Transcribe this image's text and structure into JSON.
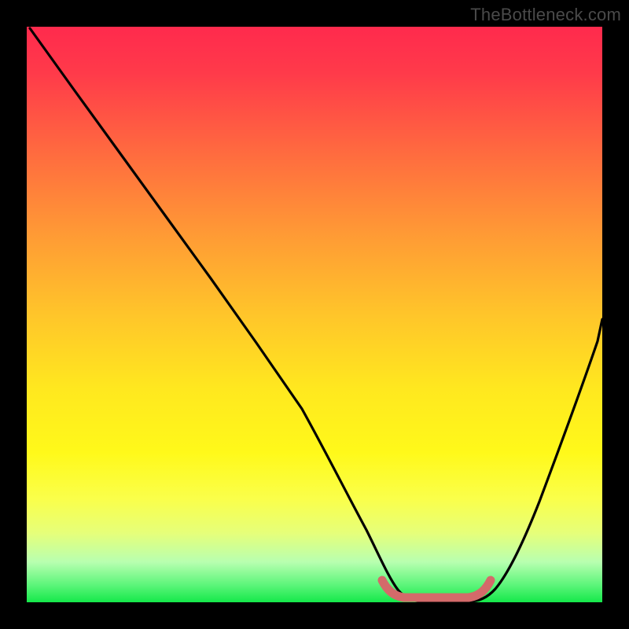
{
  "watermark": "TheBottleneck.com",
  "chart_data": {
    "type": "line",
    "title": "",
    "xlabel": "",
    "ylabel": "",
    "xlim": [
      0,
      100
    ],
    "ylim": [
      0,
      100
    ],
    "series": [
      {
        "name": "bottleneck-curve",
        "color": "#000000",
        "x": [
          0,
          8,
          16,
          24,
          32,
          40,
          48,
          56,
          60,
          63,
          66,
          70,
          74,
          78,
          82,
          86,
          90,
          94,
          98,
          100
        ],
        "values": [
          100,
          89,
          78,
          67,
          56,
          45,
          34,
          20,
          12,
          6,
          2,
          0,
          0,
          0,
          3,
          9,
          18,
          29,
          42,
          49
        ]
      },
      {
        "name": "sweet-spot-marker",
        "color": "#d96a6a",
        "x": [
          62,
          66,
          70,
          74,
          78,
          80
        ],
        "values": [
          1.2,
          0.4,
          0,
          0,
          0.4,
          1.2
        ]
      }
    ],
    "gradient_stops": [
      {
        "pos": 0,
        "color": "#ff2a4d"
      },
      {
        "pos": 50,
        "color": "#ffc52a"
      },
      {
        "pos": 75,
        "color": "#fff91a"
      },
      {
        "pos": 100,
        "color": "#15e84a"
      }
    ]
  }
}
